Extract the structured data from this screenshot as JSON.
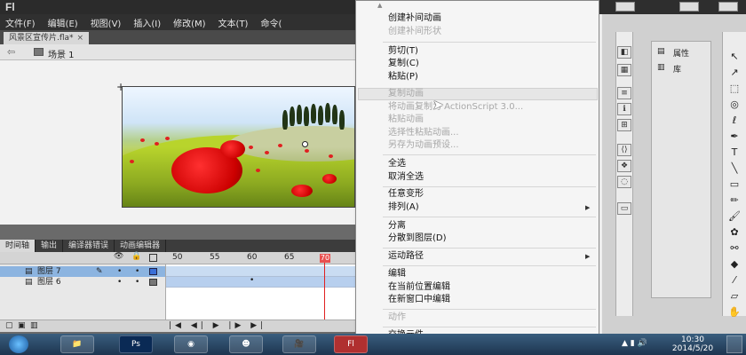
{
  "app": {
    "logo": "Fl"
  },
  "menubar": [
    "文件(F)",
    "编辑(E)",
    "视图(V)",
    "插入(I)",
    "修改(M)",
    "文本(T)",
    "命令("
  ],
  "document": {
    "tab_title": "风景区宣传片.fla*",
    "close": "×"
  },
  "scene": {
    "label": "场景 1"
  },
  "timeline": {
    "tabs": [
      "时间轴",
      "输出",
      "编译器错误",
      "动画编辑器"
    ],
    "frame_numbers": [
      "50",
      "55",
      "60",
      "65",
      "70"
    ],
    "playhead": "70",
    "layers": [
      {
        "name": "图层 7",
        "selected": true
      },
      {
        "name": "图层 6",
        "selected": false
      }
    ]
  },
  "context_menu": {
    "items": [
      {
        "label": "创建补间动画",
        "disabled": false
      },
      {
        "label": "创建补间形状",
        "disabled": true
      },
      {
        "label": "剪切(T)",
        "disabled": false
      },
      {
        "label": "复制(C)",
        "disabled": false
      },
      {
        "label": "粘贴(P)",
        "disabled": false
      },
      {
        "label": "复制动画",
        "disabled": true
      },
      {
        "label": "将动画复制为 ActionScript 3.0...",
        "disabled": true
      },
      {
        "label": "粘贴动画",
        "disabled": true
      },
      {
        "label": "选择性粘贴动画...",
        "disabled": true
      },
      {
        "label": "另存为动画预设...",
        "disabled": true
      },
      {
        "label": "全选",
        "disabled": false
      },
      {
        "label": "取消全选",
        "disabled": false
      },
      {
        "label": "任意变形",
        "disabled": false
      },
      {
        "label": "排列(A)",
        "disabled": false
      },
      {
        "label": "分离",
        "disabled": false
      },
      {
        "label": "分散到图层(D)",
        "disabled": false
      },
      {
        "label": "运动路径",
        "disabled": false
      },
      {
        "label": "编辑",
        "disabled": false
      },
      {
        "label": "在当前位置编辑",
        "disabled": false
      },
      {
        "label": "在新窗口中编辑",
        "disabled": false
      },
      {
        "label": "动作",
        "disabled": true
      },
      {
        "label": "交换元件...",
        "disabled": false
      }
    ]
  },
  "panels": {
    "properties": "属性",
    "library": "库"
  },
  "clock": {
    "time": "10:30",
    "date": "2014/5/20"
  },
  "colors": {
    "accent": "#8cb4e0",
    "playhead": "#e02020",
    "menu_bg": "#f5f5f5"
  }
}
